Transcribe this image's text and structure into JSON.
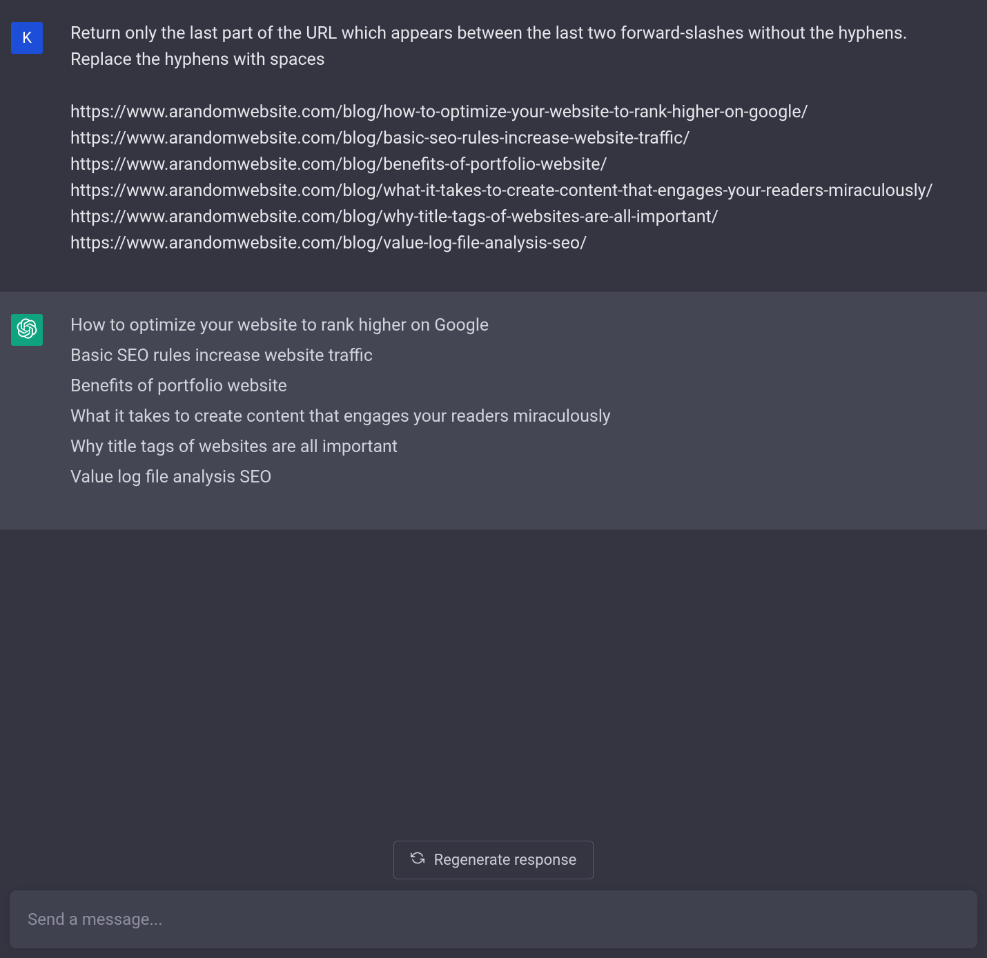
{
  "user": {
    "avatar_letter": "K",
    "prompt_intro": "Return only the last part of the URL which appears between the last two forward-slashes without the hyphens. Replace the hyphens with spaces",
    "urls": [
      "https://www.arandomwebsite.com/blog/how-to-optimize-your-website-to-rank-higher-on-google/",
      "https://www.arandomwebsite.com/blog/basic-seo-rules-increase-website-traffic/",
      "https://www.arandomwebsite.com/blog/benefits-of-portfolio-website/",
      "https://www.arandomwebsite.com/blog/what-it-takes-to-create-content-that-engages-your-readers-miraculously/",
      "https://www.arandomwebsite.com/blog/why-title-tags-of-websites-are-all-important/",
      "https://www.arandomwebsite.com/blog/value-log-file-analysis-seo/"
    ]
  },
  "assistant": {
    "lines": [
      "How to optimize your website to rank higher on Google",
      "Basic SEO rules increase website traffic",
      "Benefits of portfolio website",
      "What it takes to create content that engages your readers miraculously",
      "Why title tags of websites are all important",
      "Value log file analysis SEO"
    ]
  },
  "controls": {
    "regenerate_label": "Regenerate response",
    "input_placeholder": "Send a message..."
  }
}
